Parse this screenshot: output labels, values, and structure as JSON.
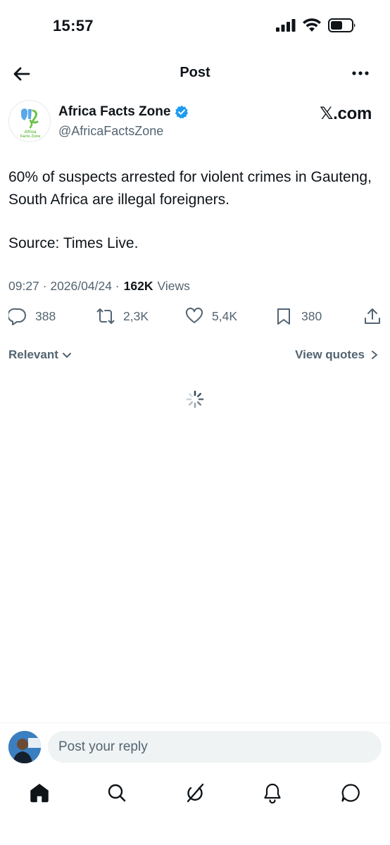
{
  "status_bar": {
    "time": "15:57",
    "icons": [
      "cellular-signal-icon",
      "wifi-icon",
      "battery-icon"
    ]
  },
  "header": {
    "title": "Post",
    "back_icon": "arrow-left-icon",
    "more_icon": "more-horizontal-icon"
  },
  "post": {
    "author": {
      "name": "Africa Facts Zone",
      "handle": "@AfricaFactsZone",
      "verified": true,
      "avatar_text": "Africa Facts Zone"
    },
    "source_badge": "𝕏.com",
    "text_line1": "60% of suspects arrested for violent crimes in Gauteng, South Africa are illegal foreigners.",
    "text_line2": "Source: Times Live.",
    "timestamp": "09:27 · 2026/04/24 ·",
    "views_count": "162K",
    "views_label": "Views",
    "stats": {
      "replies": "388",
      "reposts": "2,3K",
      "likes": "5,4K",
      "bookmarks": "380"
    }
  },
  "replies_section": {
    "sort_label": "Relevant",
    "view_quotes_label": "View quotes"
  },
  "reply_bar": {
    "placeholder": "Post your reply"
  },
  "bottom_nav": {
    "items": [
      "home-icon",
      "search-icon",
      "grok-icon",
      "notifications-icon",
      "messages-icon"
    ]
  },
  "colors": {
    "text_primary": "#0f1419",
    "text_secondary": "#536471",
    "verified_blue": "#1d9bf0",
    "input_bg": "#eff3f4"
  }
}
